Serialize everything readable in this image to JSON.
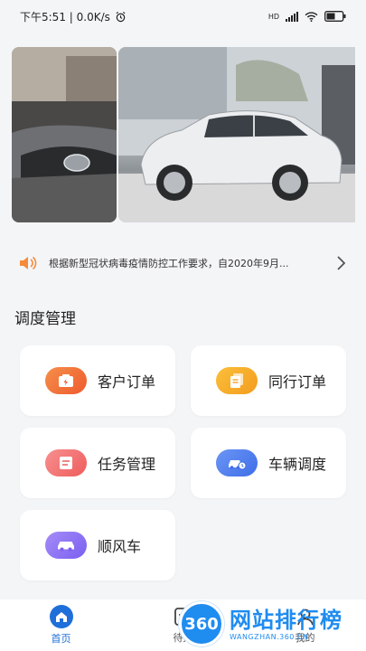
{
  "status_bar": {
    "time_speed": "下午5:51 | 0.0K/s",
    "network": "HD"
  },
  "notice": {
    "text": "根据新型冠状病毒疫情防控工作要求，自2020年9月..."
  },
  "section": {
    "title": "调度管理"
  },
  "cards": [
    {
      "label": "客户订单",
      "icon": "order-icon",
      "color": "#f26b3a"
    },
    {
      "label": "同行订单",
      "icon": "document-icon",
      "color": "#f5a623"
    },
    {
      "label": "任务管理",
      "icon": "task-icon",
      "color": "#f26d6d"
    },
    {
      "label": "车辆调度",
      "icon": "vehicle-dispatch-icon",
      "color": "#4a7cf0"
    },
    {
      "label": "顺风车",
      "icon": "car-icon",
      "color": "#8a72f0"
    }
  ],
  "tabbar": {
    "tabs": [
      {
        "label": "首页",
        "icon": "home-icon",
        "active": true
      },
      {
        "label": "待办",
        "icon": "todo-icon",
        "active": false
      },
      {
        "label": "我的",
        "icon": "profile-icon",
        "active": false
      }
    ]
  },
  "watermark": {
    "logo": "360",
    "title": "网站排行榜",
    "url": "WANGZHAN.360.CN"
  }
}
